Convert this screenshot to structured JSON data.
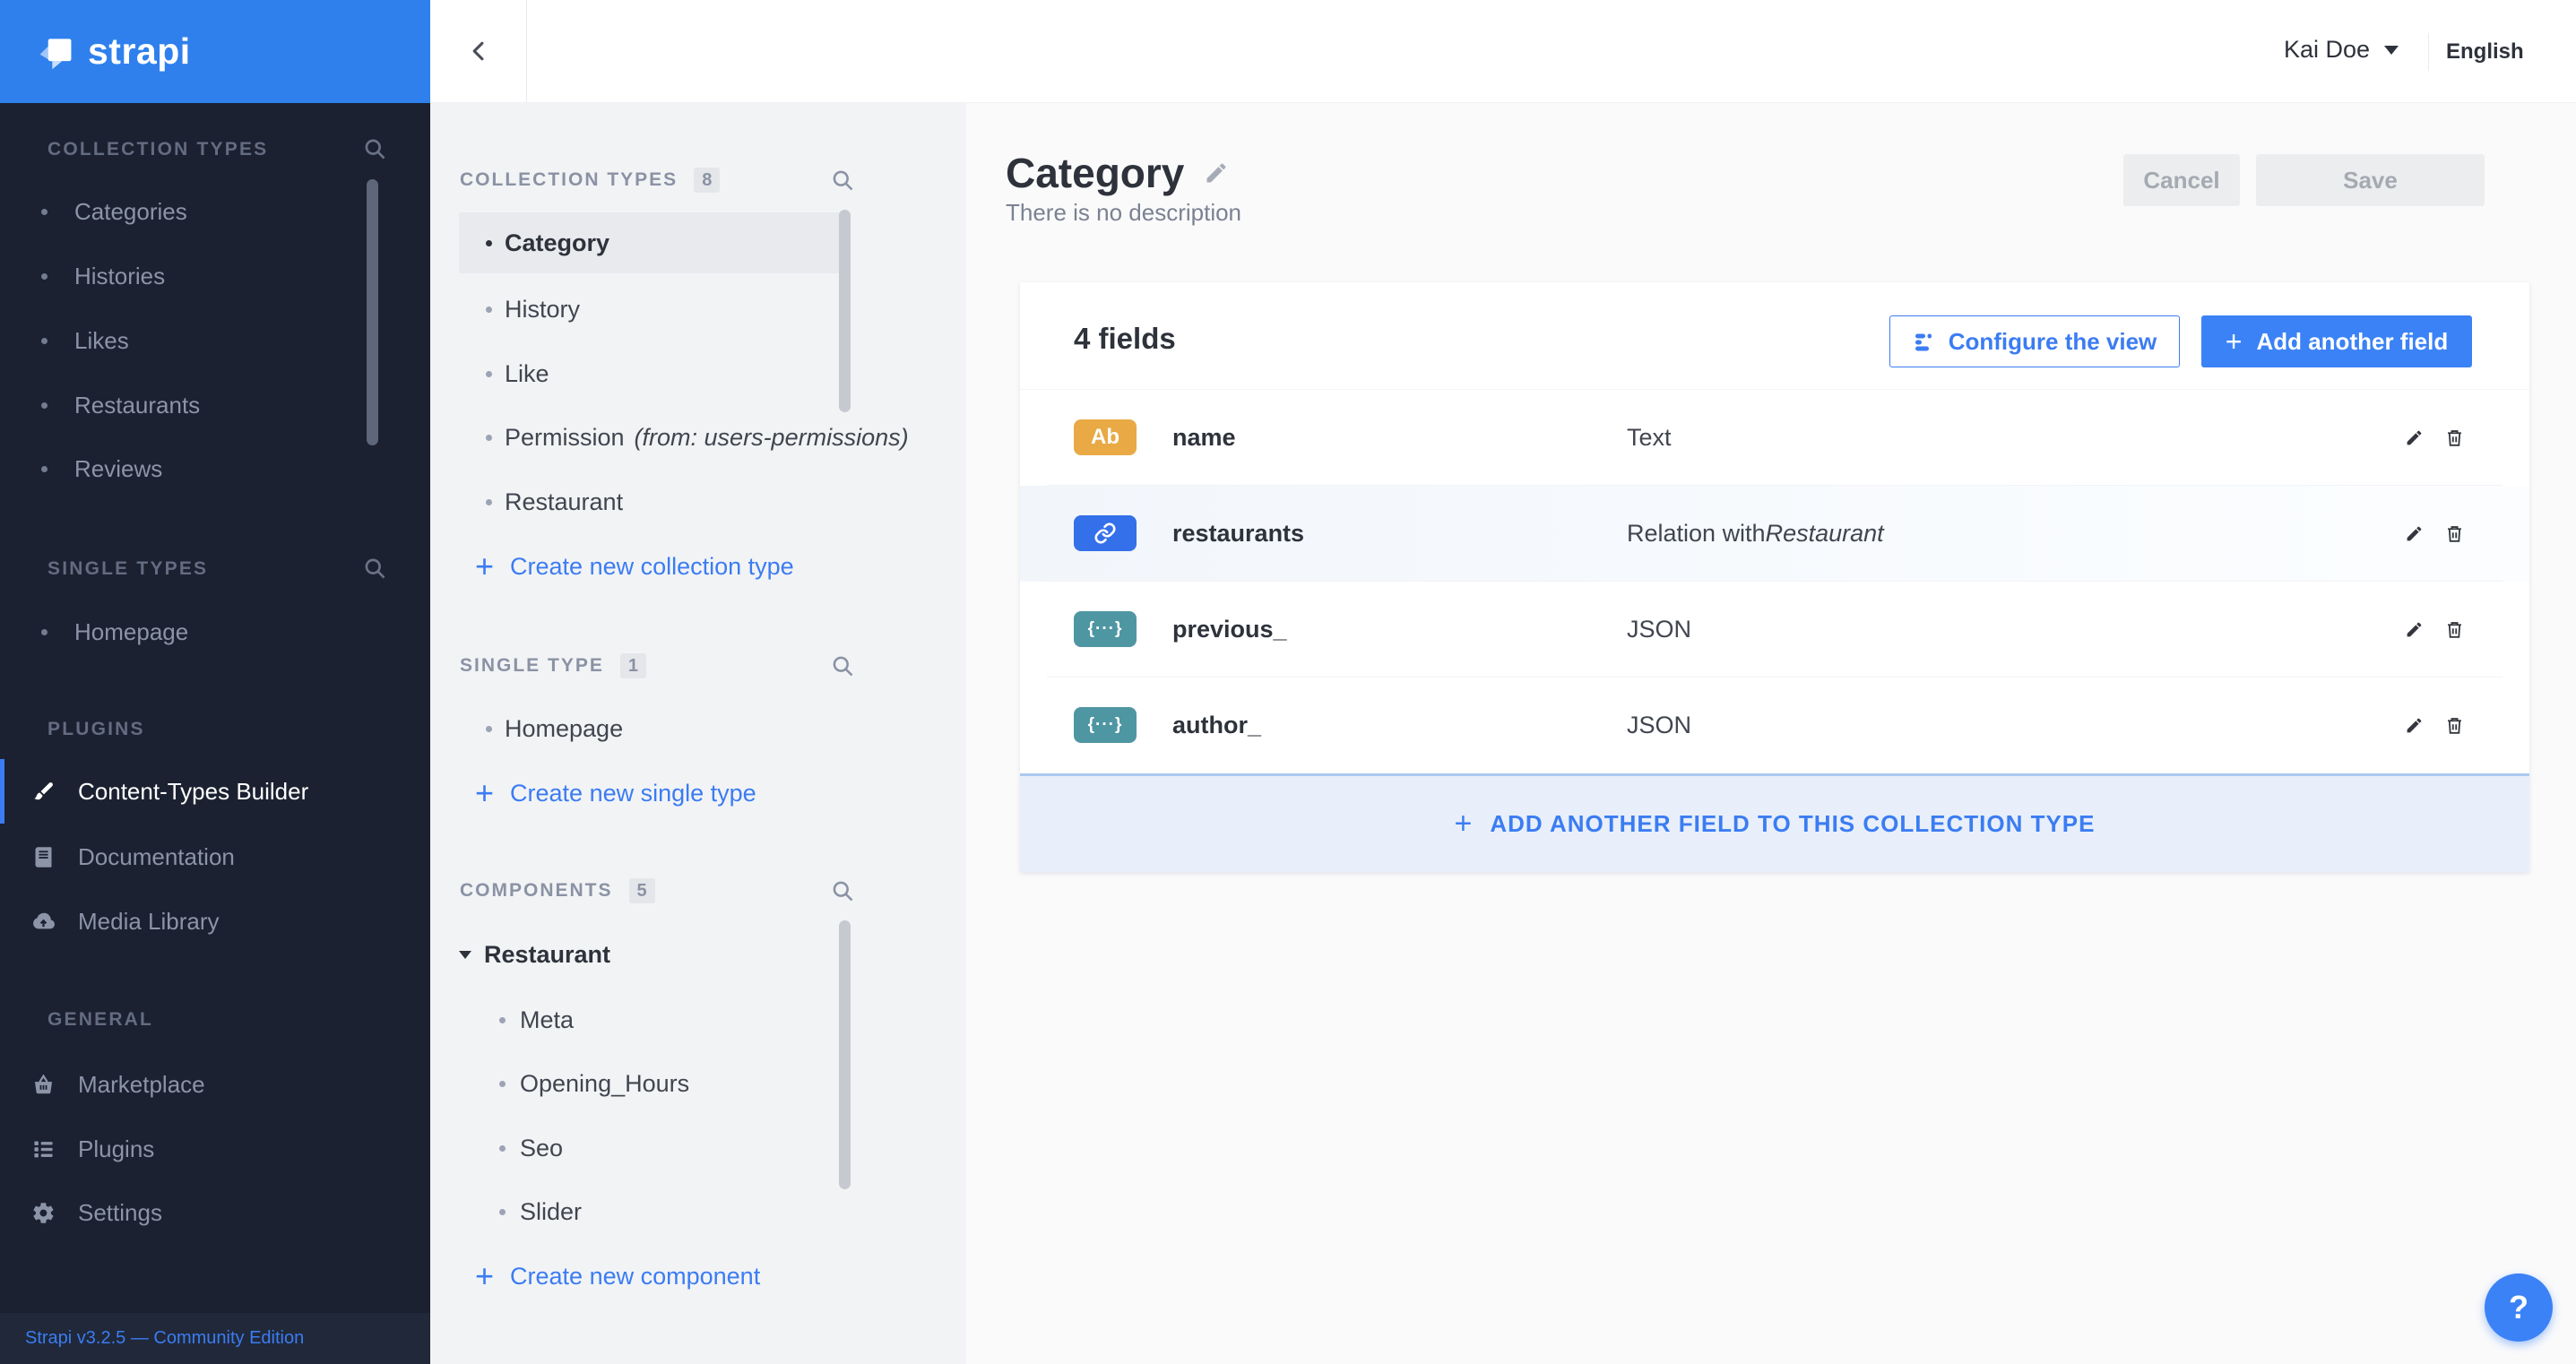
{
  "logo": {
    "text": "strapi"
  },
  "topbar": {
    "user": "Kai Doe",
    "language": "English"
  },
  "sidebar": {
    "sections": {
      "collection": {
        "title": "COLLECTION TYPES",
        "items": [
          "Categories",
          "Histories",
          "Likes",
          "Restaurants",
          "Reviews"
        ]
      },
      "single": {
        "title": "SINGLE TYPES",
        "items": [
          "Homepage"
        ]
      },
      "plugins": {
        "title": "PLUGINS",
        "items": [
          "Content-Types Builder",
          "Documentation",
          "Media Library"
        ]
      },
      "general": {
        "title": "GENERAL",
        "items": [
          "Marketplace",
          "Plugins",
          "Settings"
        ]
      }
    },
    "footer": "Strapi v3.2.5 — Community Edition"
  },
  "subnav": {
    "collection": {
      "title": "COLLECTION TYPES",
      "count": "8",
      "items": [
        {
          "label": "Category"
        },
        {
          "label": "History"
        },
        {
          "label": "Like"
        },
        {
          "label": "Permission",
          "suffix": "(from: users-permissions)"
        },
        {
          "label": "Restaurant"
        }
      ],
      "create": "Create new collection type"
    },
    "single": {
      "title": "SINGLE TYPE",
      "count": "1",
      "items": [
        {
          "label": "Homepage"
        }
      ],
      "create": "Create new single type"
    },
    "components": {
      "title": "COMPONENTS",
      "count": "5",
      "group": "Restaurant",
      "items": [
        "Meta",
        "Opening_Hours",
        "Seo",
        "Slider"
      ],
      "create": "Create new component"
    }
  },
  "page": {
    "title": "Category",
    "description": "There is no description",
    "cancel": "Cancel",
    "save": "Save"
  },
  "fields": {
    "count_label": "4 fields",
    "configure": "Configure the view",
    "add": "Add another field",
    "rows": [
      {
        "icon": "Ab",
        "icon_type": "text",
        "name": "name",
        "type": "Text"
      },
      {
        "icon": "link",
        "icon_type": "relation",
        "name": "restaurants",
        "type": "Relation with ",
        "type_italic": "Restaurant"
      },
      {
        "icon": "{···}",
        "icon_type": "json",
        "name": "previous_",
        "type": "JSON"
      },
      {
        "icon": "{···}",
        "icon_type": "json",
        "name": "author_",
        "type": "JSON"
      }
    ],
    "footer_add": "ADD ANOTHER FIELD TO THIS COLLECTION TYPE"
  },
  "help": "?",
  "colors": {
    "logo_bg": "#2F80ED",
    "primary": "#3B7CF2",
    "button_blue": "#3B82F6",
    "sidebar_bg": "#1B2130",
    "panel_bg": "#F2F3F5",
    "text_badge": "#E9A944",
    "relation_badge": "#3470EA",
    "json_badge": "#4F96A3",
    "card_footer_bg": "#E8EFFA"
  }
}
